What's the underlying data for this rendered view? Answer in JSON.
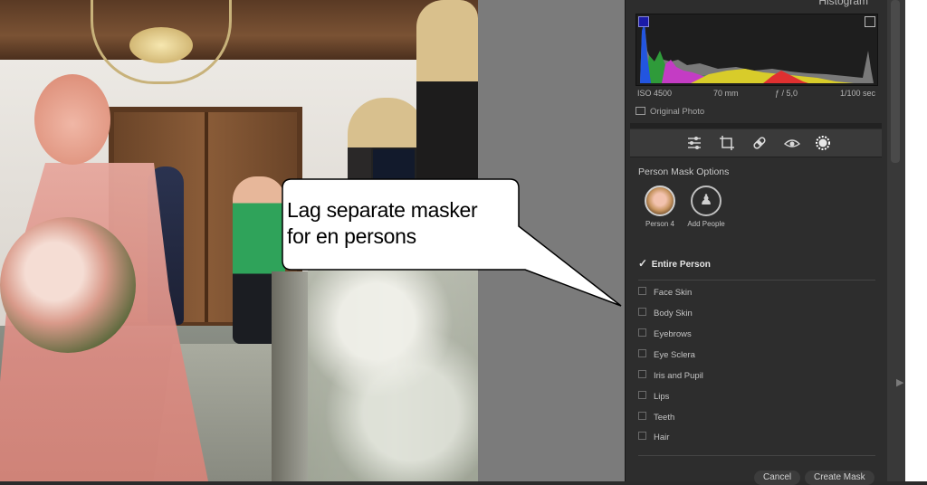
{
  "panel": {
    "title": "Histogram",
    "exif": {
      "iso": "ISO 4500",
      "focal": "70 mm",
      "aperture": "ƒ / 5,0",
      "shutter": "1/100 sec"
    },
    "original_photo": "Original Photo",
    "tools": [
      "sliders-icon",
      "crop-icon",
      "heal-icon",
      "redeye-icon",
      "mask-icon"
    ]
  },
  "mask_options": {
    "title": "Person Mask Options",
    "people": [
      {
        "label": "Person 4",
        "icon": "person-avatar"
      },
      {
        "label": "Add People",
        "icon": "add-people-icon"
      }
    ],
    "entire_person": {
      "label": "Entire Person",
      "checked": true
    },
    "parts": [
      {
        "label": "Face Skin",
        "checked": false
      },
      {
        "label": "Body Skin",
        "checked": false
      },
      {
        "label": "Eyebrows",
        "checked": false
      },
      {
        "label": "Eye Sclera",
        "checked": false
      },
      {
        "label": "Iris and Pupil",
        "checked": false
      },
      {
        "label": "Lips",
        "checked": false
      },
      {
        "label": "Teeth",
        "checked": false
      },
      {
        "label": "Hair",
        "checked": false
      }
    ],
    "buttons": {
      "cancel": "Cancel",
      "create": "Create Mask"
    }
  },
  "callout": {
    "line1": "Lag separate masker",
    "line2": "for en persons"
  },
  "colors": {
    "panel_bg": "#2d2d2d",
    "mask_overlay": "#e08a80",
    "callout_fill": "#ffffff"
  }
}
